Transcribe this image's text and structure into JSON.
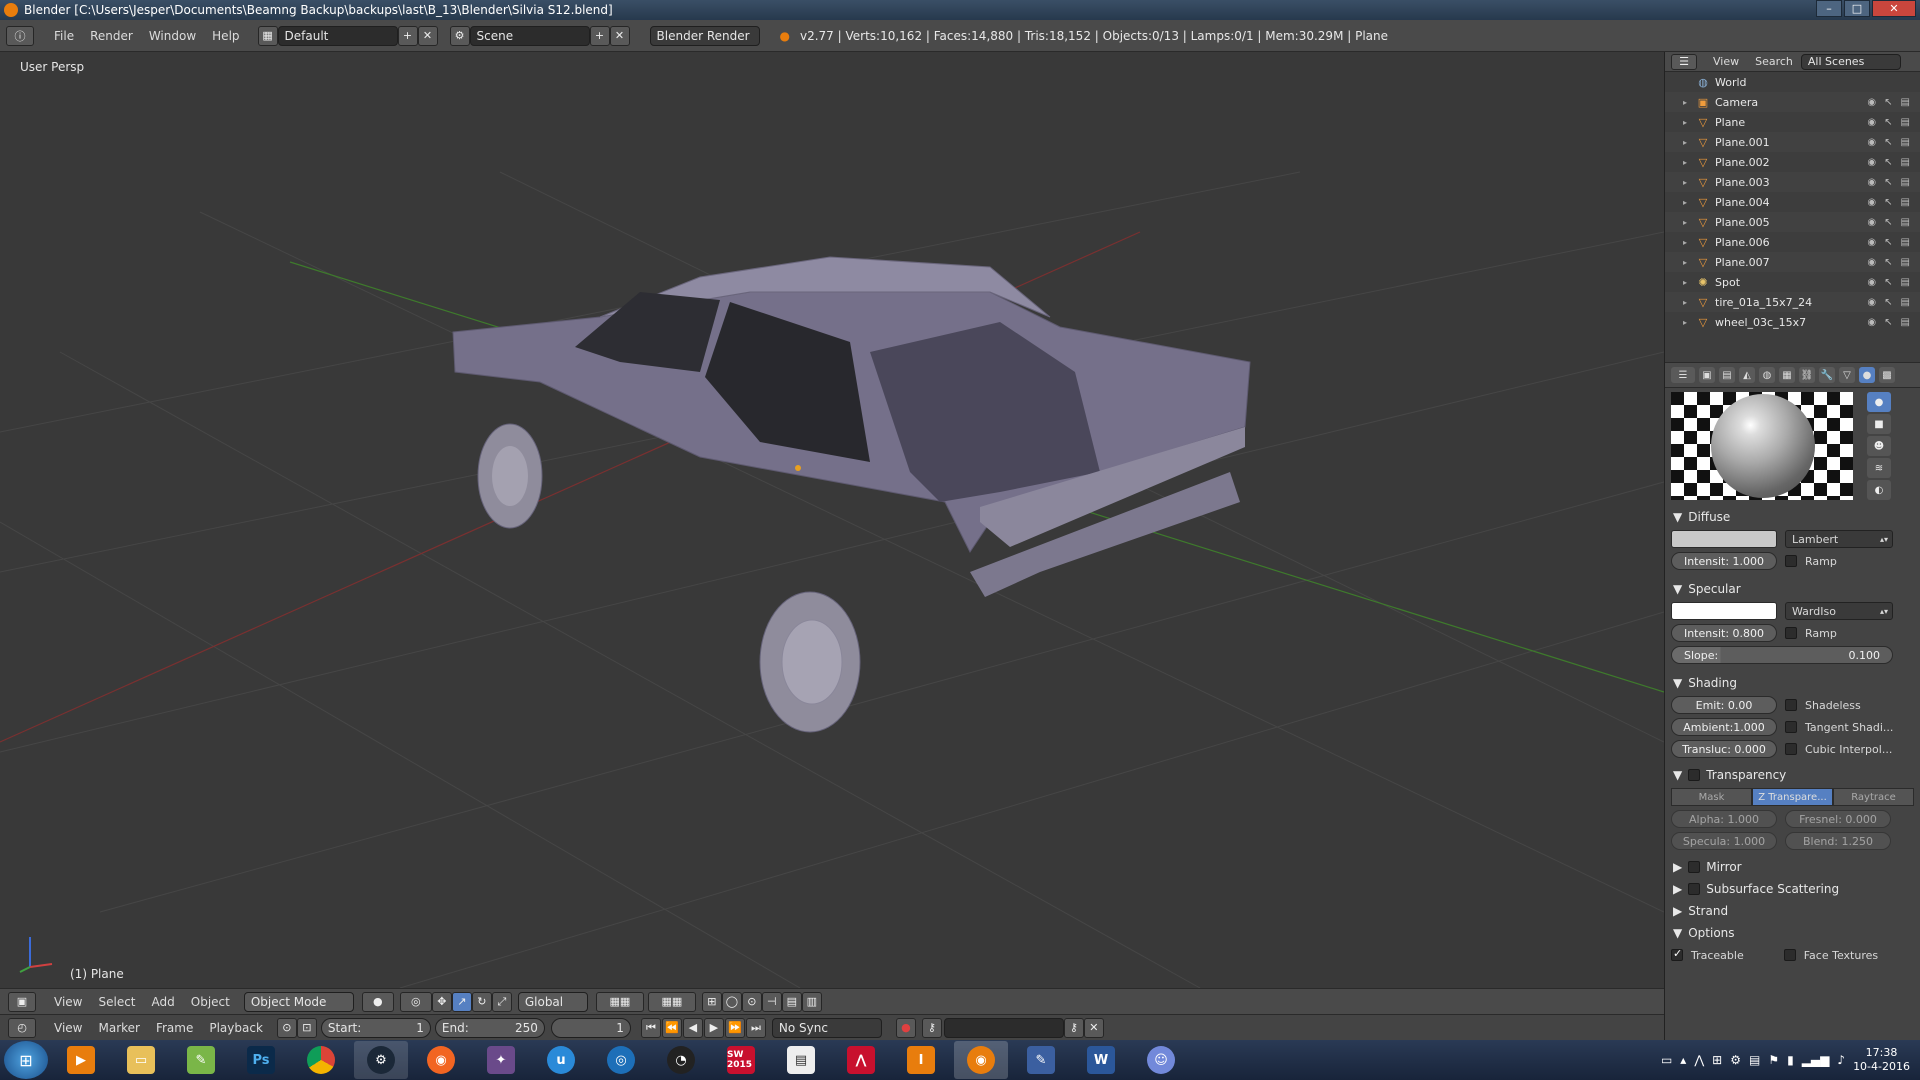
{
  "titlebar": {
    "title": "Blender [C:\\Users\\Jesper\\Documents\\Beamng Backup\\backups\\last\\B_13\\Blender\\Silvia S12.blend]",
    "min": "–",
    "max": "□",
    "close": "✕"
  },
  "infobar": {
    "menus": [
      "File",
      "Render",
      "Window",
      "Help"
    ],
    "layout": "Default",
    "scene": "Scene",
    "engine": "Blender Render",
    "stats": "v2.77 | Verts:10,162 | Faces:14,880 | Tris:18,152 | Objects:0/13 | Lamps:0/1 | Mem:30.29M | Plane"
  },
  "viewport": {
    "view_label": "User Persp",
    "object_label": "(1) Plane"
  },
  "viewport_header": {
    "menus": [
      "View",
      "Select",
      "Add",
      "Object"
    ],
    "mode": "Object Mode",
    "orientation": "Global"
  },
  "timeline": {
    "menus": [
      "View",
      "Marker",
      "Frame",
      "Playback"
    ],
    "start_label": "Start:",
    "start": "1",
    "end_label": "End:",
    "end": "250",
    "current": "1",
    "sync": "No Sync"
  },
  "outliner": {
    "header": {
      "view": "View",
      "search": "Search",
      "filter": "All Scenes"
    },
    "items": [
      {
        "name": "World",
        "icon": "world-icon"
      },
      {
        "name": "Camera",
        "icon": "camera-icon"
      },
      {
        "name": "Plane",
        "icon": "mesh-icon"
      },
      {
        "name": "Plane.001",
        "icon": "mesh-icon"
      },
      {
        "name": "Plane.002",
        "icon": "mesh-icon"
      },
      {
        "name": "Plane.003",
        "icon": "mesh-icon"
      },
      {
        "name": "Plane.004",
        "icon": "mesh-icon"
      },
      {
        "name": "Plane.005",
        "icon": "mesh-icon"
      },
      {
        "name": "Plane.006",
        "icon": "mesh-icon"
      },
      {
        "name": "Plane.007",
        "icon": "mesh-icon"
      },
      {
        "name": "Spot",
        "icon": "lamp-icon"
      },
      {
        "name": "tire_01a_15x7_24",
        "icon": "mesh-icon"
      },
      {
        "name": "wheel_03c_15x7",
        "icon": "mesh-icon"
      }
    ]
  },
  "material": {
    "diffuse": {
      "title": "Diffuse",
      "shader": "Lambert",
      "intensity": "Intensit: 1.000",
      "ramp": "Ramp",
      "color": "#c9c9c9"
    },
    "specular": {
      "title": "Specular",
      "shader": "WardIso",
      "intensity": "Intensit: 0.800",
      "ramp": "Ramp",
      "slope_label": "Slope:",
      "slope": "0.100",
      "color": "#ffffff"
    },
    "shading": {
      "title": "Shading",
      "emit": "Emit: 0.00",
      "ambient": "Ambient:1.000",
      "transluc": "Transluc: 0.000",
      "shadeless": "Shadeless",
      "tangent": "Tangent Shadi...",
      "cubic": "Cubic Interpol..."
    },
    "transparency": {
      "title": "Transparency",
      "modes": [
        "Mask",
        "Z Transpare...",
        "Raytrace"
      ],
      "alpha": "Alpha: 1.000",
      "fresnel": "Fresnel: 0.000",
      "specula": "Specula: 1.000",
      "blend": "Blend: 1.250"
    },
    "mirror": "Mirror",
    "sss": "Subsurface Scattering",
    "strand": "Strand",
    "options": {
      "title": "Options",
      "traceable": "Traceable",
      "face_textures": "Face Textures"
    }
  },
  "taskbar": {
    "apps": [
      "Media Player",
      "Explorer",
      "Notepad++",
      "Ps",
      "Chrome",
      "Steam",
      "Origin",
      "Game",
      "Uplay",
      "Network",
      "Obs",
      "SW 2015",
      "Notes",
      "Acrobat",
      "Inventor",
      "Blender",
      "Tool",
      "Word",
      "Discord"
    ],
    "time": "17:38",
    "date": "10-4-2016"
  }
}
